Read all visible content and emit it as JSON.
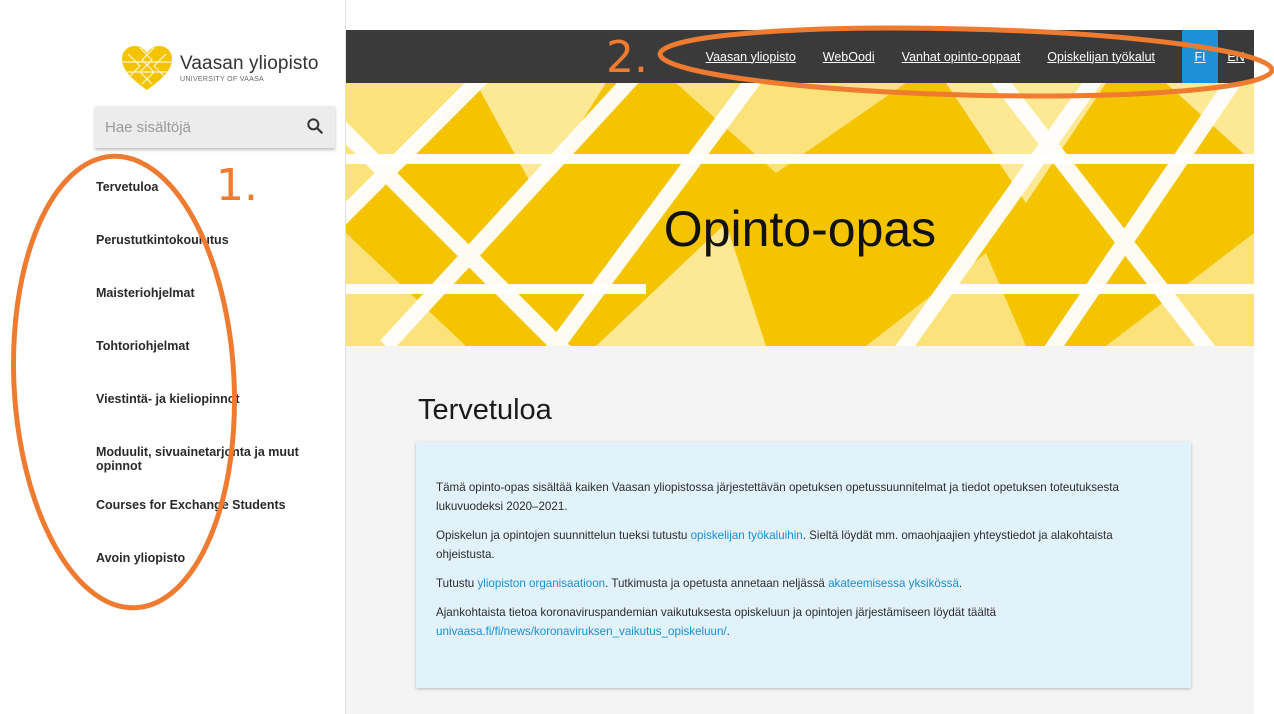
{
  "brand": {
    "name": "Vaasan yliopisto",
    "sub": "UNIVERSITY OF VAASA",
    "logo_color": "#f5c400"
  },
  "search": {
    "placeholder": "Hae sisältöjä",
    "icon": "search-icon"
  },
  "sidebar": {
    "items": [
      {
        "label": "Tervetuloa"
      },
      {
        "label": "Perustutkintokoulutus"
      },
      {
        "label": "Maisteriohjelmat"
      },
      {
        "label": "Tohtoriohjelmat"
      },
      {
        "label": "Viestintä- ja kieliopinnot"
      },
      {
        "label": "Moduulit, sivuainetarjonta ja muut opinnot"
      },
      {
        "label": "Courses for Exchange Students"
      },
      {
        "label": "Avoin yliopisto"
      }
    ]
  },
  "topnav": {
    "links": [
      "Vaasan yliopisto",
      "WebOodi",
      "Vanhat opinto-oppaat",
      "Opiskelijan työkalut"
    ],
    "lang_fi": "FI",
    "lang_en": "EN",
    "bg_color": "#3a3a3a",
    "active_color": "#1e90d8"
  },
  "hero": {
    "title": "Opinto-opas",
    "color": "#f5c400"
  },
  "main": {
    "heading": "Tervetuloa",
    "p1": "Tämä opinto-opas sisältää kaiken Vaasan yliopistossa järjestettävän opetuksen opetussuunnitelmat ja tiedot opetuksen toteutuksesta lukuvuodeksi 2020–2021.",
    "p2_before": "Opiskelun ja opintojen suunnittelun tueksi tutustu ",
    "p2_link": "opiskelijan työkaluihin",
    "p2_after": ". Sieltä löydät mm. omaohjaajien yhteystiedot ja alakohtaista ohjeistusta.",
    "p3_before": "Tutustu ",
    "p3_link1": "yliopiston organisaatioon",
    "p3_mid": ". Tutkimusta ja opetusta annetaan neljässä ",
    "p3_link2": "akateemisessa yksikössä",
    "p3_after": ".",
    "p4_text": "Ajankohtaista tietoa koronaviruspandemian vaikutuksesta opiskeluun ja opintojen järjestämiseen löydät täältä",
    "p4_link": "univaasa.fi/fi/news/koronaviruksen_vaikutus_opiskeluun/",
    "p4_after": ".",
    "link_color": "#1a8ed6",
    "box_color": "#e2f2fb"
  },
  "annotations": {
    "label1": "1.",
    "label2": "2.",
    "color": "#ee7b30"
  }
}
